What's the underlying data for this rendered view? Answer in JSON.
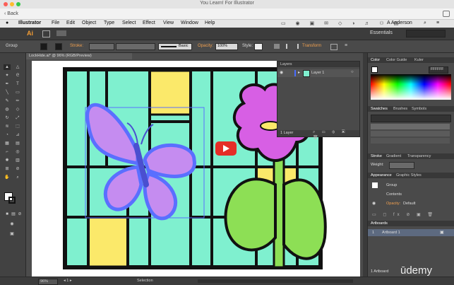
{
  "window": {
    "title": "You Learn! For Illustrator"
  },
  "nav": {
    "back_label": "Back"
  },
  "menu": {
    "app_name": "Illustrator",
    "items": [
      "File",
      "Edit",
      "Object",
      "Type",
      "Select",
      "Effect",
      "View",
      "Window",
      "Help"
    ],
    "user": "A Anderson"
  },
  "appbar": {
    "logo": "Ai",
    "workspace": "Essentials"
  },
  "control": {
    "selection": "Group",
    "stroke_label": "Stroke:",
    "brush_label": "Basic",
    "opacity_label": "Opacity:",
    "opacity_value": "100%",
    "style_label": "Style:",
    "transform_label": "Transform"
  },
  "document": {
    "tab": "LockHide.ai* @ 96% (RGB/Preview)"
  },
  "layers_panel": {
    "title": "Layers",
    "layer_name": "Layer 1",
    "count": "1 Layer"
  },
  "color_panel": {
    "tabs": [
      "Color",
      "Color Guide",
      "Kuler"
    ],
    "hex": "FFFFFF"
  },
  "swatches_panel": {
    "tabs": [
      "Swatches",
      "Brushes",
      "Symbols"
    ]
  },
  "stroke_panel": {
    "tabs": [
      "Stroke",
      "Gradient",
      "Transparency"
    ],
    "weight_label": "Weight:"
  },
  "appearance_panel": {
    "tabs": [
      "Appearance",
      "Graphic Styles"
    ],
    "group_label": "Group",
    "contents_label": "Contents",
    "opacity_label": "Opacity:",
    "opacity_value": "Default"
  },
  "artboards_panel": {
    "title": "Artboards",
    "item_index": "1",
    "item_name": "Artboard 1",
    "count": "1 Artboard"
  },
  "status": {
    "zoom": "96%",
    "page": "1",
    "tool": "Selection"
  },
  "watermark": {
    "text": "ūdemy"
  },
  "colors": {
    "teal": "#7ff0cf",
    "yellow": "#fbe96a",
    "magenta": "#d75fe4",
    "green": "#8ddf55",
    "butterfly": "#c58cf0",
    "selection_blue": "#5a6fff"
  }
}
